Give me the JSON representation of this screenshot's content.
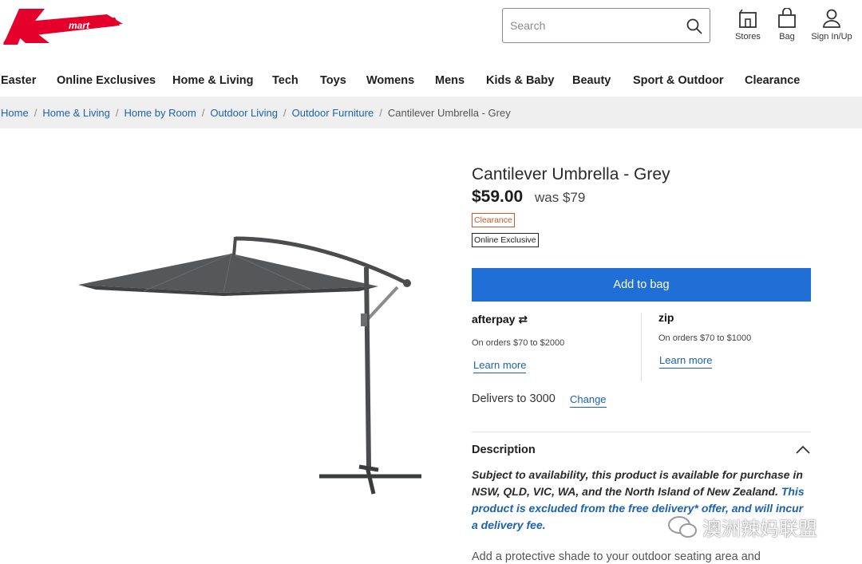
{
  "header": {
    "logo_text": "Kmart",
    "search_placeholder": "Search",
    "stores_label": "Stores",
    "bag_label": "Bag",
    "signin_label": "Sign In/Up"
  },
  "nav": [
    "Easter",
    "Online Exclusives",
    "Home & Living",
    "Tech",
    "Toys",
    "Womens",
    "Mens",
    "Kids & Baby",
    "Beauty",
    "Sport & Outdoor",
    "Clearance"
  ],
  "breadcrumb": {
    "links": [
      "Home",
      "Home & Living",
      "Home by Room",
      "Outdoor Living",
      "Outdoor Furniture"
    ],
    "current": "Cantilever Umbrella - Grey"
  },
  "product": {
    "title": "Cantilever Umbrella - Grey",
    "price": "$59.00",
    "was_price": "was $79",
    "badge_clearance": "Clearance",
    "badge_online": "Online Exclusive",
    "add_to_bag": "Add to bag"
  },
  "payments": {
    "afterpay": {
      "brand": "afterpay",
      "terms": "On orders $70 to $2000",
      "learn": "Learn more"
    },
    "zip": {
      "brand": "zip",
      "terms": "On orders $70 to $1000",
      "learn": "Learn more"
    }
  },
  "delivery": {
    "text": "Delivers to 3000",
    "change": "Change"
  },
  "description": {
    "heading": "Description",
    "line_bold": "Subject to availability, this product is available for purchase in NSW, QLD, VIC, WA, and the North Island of New Zealand.",
    "line_blue": "This product is excluded from the free delivery* offer, and will incur a delivery fee.",
    "body": "Add a protective shade to your outdoor seating area and"
  },
  "watermark": "澳洲辣妈联盟",
  "colors": {
    "brand_red": "#e4002b",
    "button_blue": "#1f6fd6",
    "link_blue": "#1b62b5",
    "clearance": "#c9562c"
  }
}
